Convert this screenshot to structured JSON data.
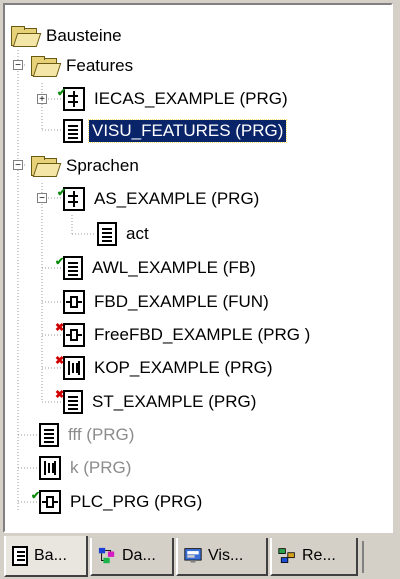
{
  "tree": {
    "root": {
      "label": "Bausteine"
    },
    "features": {
      "label": "Features",
      "items": [
        {
          "label": "IECAS_EXAMPLE (PRG)",
          "icon": "sfc-icon",
          "status": "ok"
        },
        {
          "label": "VISU_FEATURES (PRG)",
          "icon": "document-icon",
          "selected": true
        }
      ]
    },
    "sprachen": {
      "label": "Sprachen",
      "items": [
        {
          "label": "AS_EXAMPLE (PRG)",
          "icon": "sfc-icon",
          "status": "ok"
        },
        {
          "label": "act",
          "icon": "document-icon"
        },
        {
          "label": "AWL_EXAMPLE (FB)",
          "icon": "document-icon",
          "status": "ok"
        },
        {
          "label": "FBD_EXAMPLE (FUN)",
          "icon": "fbd-icon"
        },
        {
          "label": "FreeFBD_EXAMPLE (PRG  )",
          "icon": "fbd-icon",
          "status": "error"
        },
        {
          "label": "KOP_EXAMPLE (PRG)",
          "icon": "ladder-icon",
          "status": "error"
        },
        {
          "label": "ST_EXAMPLE (PRG)",
          "icon": "document-icon",
          "status": "error"
        }
      ]
    },
    "root_items": [
      {
        "label": "fff (PRG)",
        "icon": "document-icon",
        "disabled": true
      },
      {
        "label": "k (PRG)",
        "icon": "ladder-icon",
        "disabled": true
      },
      {
        "label": "PLC_PRG (PRG)",
        "icon": "fbd-icon",
        "status": "ok"
      }
    ]
  },
  "tabs": [
    {
      "label": "Ba...",
      "icon": "pou-tab-icon",
      "active": true
    },
    {
      "label": "Da...",
      "icon": "datatypes-tab-icon"
    },
    {
      "label": "Vis...",
      "icon": "visualization-tab-icon"
    },
    {
      "label": "Re...",
      "icon": "resources-tab-icon"
    }
  ],
  "colors": {
    "selection": "#0a246a",
    "ok_mark": "#0a8a0a",
    "error_mark": "#d10000",
    "disabled_text": "#8c8c8c"
  }
}
